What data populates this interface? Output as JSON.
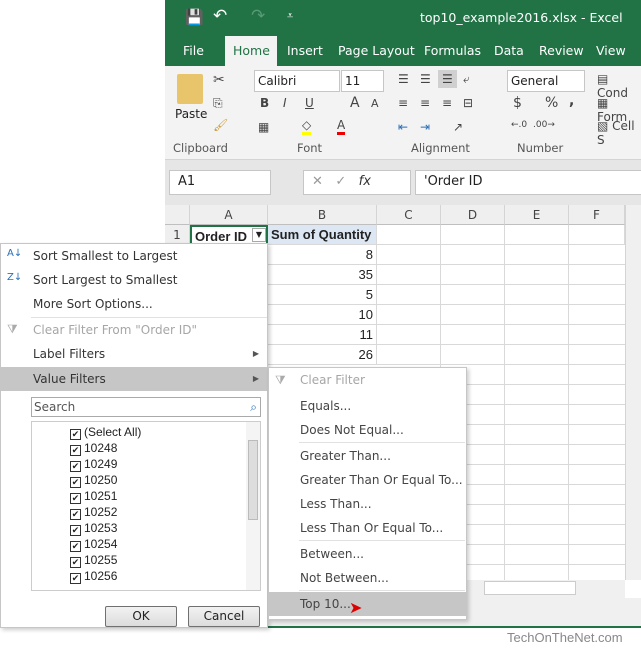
{
  "window": {
    "title": "top10_example2016.xlsx  -  Excel"
  },
  "ribbon_tabs": [
    "File",
    "Home",
    "Insert",
    "Page Layout",
    "Formulas",
    "Data",
    "Review",
    "View"
  ],
  "active_tab": "Home",
  "ribbon": {
    "paste": "Paste",
    "clipboard": "Clipboard",
    "font_name": "Calibri",
    "font_size": "11",
    "font": "Font",
    "alignment": "Alignment",
    "number_format": "General",
    "number": "Number",
    "styles": [
      "Cond",
      "Form",
      "Cell S"
    ],
    "bold": "B",
    "italic": "I",
    "underline": "U",
    "currency": "$",
    "percent": "%",
    "comma": ","
  },
  "formula_bar": {
    "name_box": "A1",
    "fx": "fx",
    "value": "'Order ID"
  },
  "columns": [
    "A",
    "B",
    "C",
    "D",
    "E",
    "F"
  ],
  "row_numbers": [
    "1"
  ],
  "header_cells": {
    "a1": "Order ID",
    "b1": "Sum of Quantity"
  },
  "quantities": [
    "8",
    "35",
    "5",
    "10",
    "11",
    "26"
  ],
  "filter_menu": {
    "sort_asc": "Sort Smallest to Largest",
    "sort_desc": "Sort Largest to Smallest",
    "more_sort": "More Sort Options...",
    "clear_filter": "Clear Filter From \"Order ID\"",
    "label_filters": "Label Filters",
    "value_filters": "Value Filters",
    "search_placeholder": "Search",
    "items": [
      "(Select All)",
      "10248",
      "10249",
      "10250",
      "10251",
      "10252",
      "10253",
      "10254",
      "10255",
      "10256"
    ],
    "ok": "OK",
    "cancel": "Cancel"
  },
  "value_filters_submenu": [
    "Clear Filter",
    "Equals...",
    "Does Not Equal...",
    "Greater Than...",
    "Greater Than Or Equal To...",
    "Less Than...",
    "Less Than Or Equal To...",
    "Between...",
    "Not Between...",
    "Top 10..."
  ],
  "highlighted": "Top 10...",
  "watermark": "TechOnTheNet.com",
  "colors": {
    "excel_green": "#217346",
    "highlight": "#c6c6c6"
  }
}
